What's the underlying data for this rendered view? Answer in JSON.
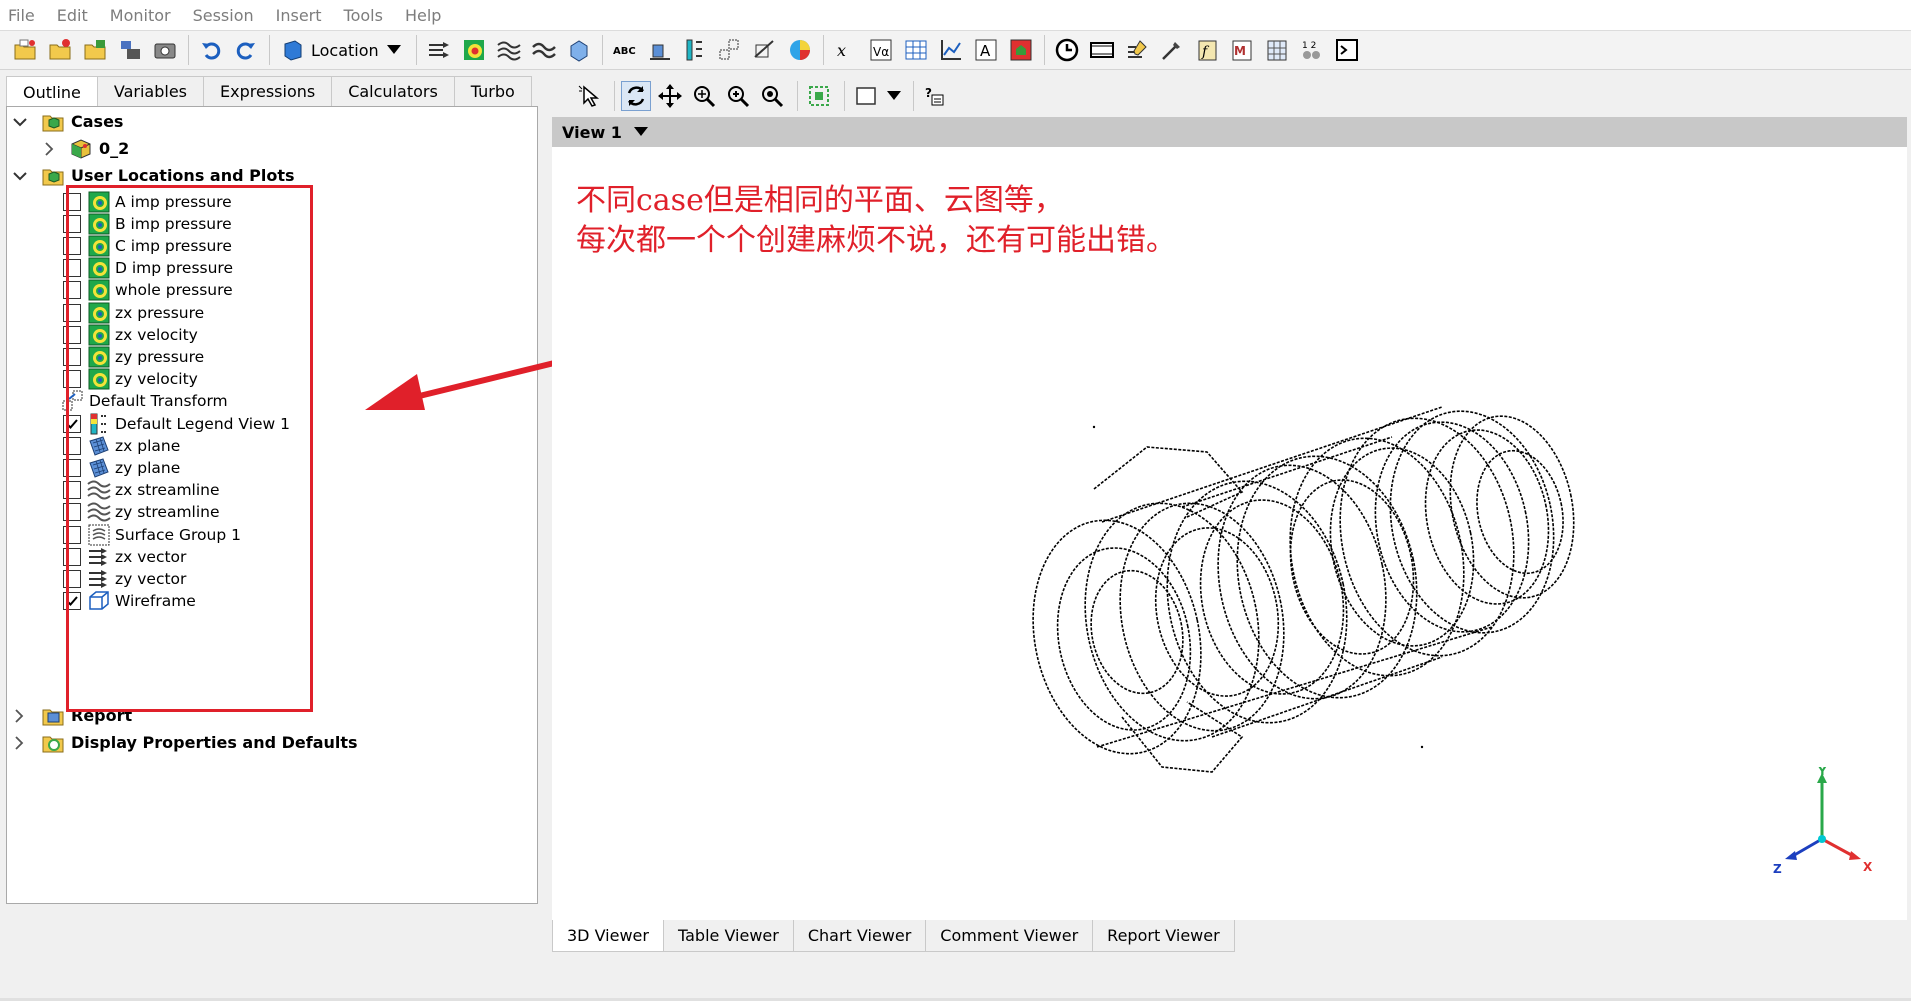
{
  "menu": [
    "File",
    "Edit",
    "Monitor",
    "Session",
    "Insert",
    "Tools",
    "Help"
  ],
  "toolbar": {
    "location_label": "Location"
  },
  "left_tabs": [
    {
      "label": "Outline",
      "active": true
    },
    {
      "label": "Variables",
      "active": false
    },
    {
      "label": "Expressions",
      "active": false
    },
    {
      "label": "Calculators",
      "active": false
    },
    {
      "label": "Turbo",
      "active": false
    }
  ],
  "tree": {
    "cases": {
      "label": "Cases",
      "children": [
        {
          "label": "0_2"
        }
      ]
    },
    "user_locations": {
      "label": "User Locations and Plots",
      "items": [
        {
          "label": "A imp pressure",
          "icon": "contour-icon",
          "checked": false
        },
        {
          "label": "B imp pressure",
          "icon": "contour-icon",
          "checked": false
        },
        {
          "label": "C imp pressure",
          "icon": "contour-icon",
          "checked": false
        },
        {
          "label": "D imp pressure",
          "icon": "contour-icon",
          "checked": false
        },
        {
          "label": "whole pressure",
          "icon": "contour-icon",
          "checked": false
        },
        {
          "label": "zx pressure",
          "icon": "contour-icon",
          "checked": false
        },
        {
          "label": "zx velocity",
          "icon": "contour-icon",
          "checked": false
        },
        {
          "label": "zy pressure",
          "icon": "contour-icon",
          "checked": false
        },
        {
          "label": "zy velocity",
          "icon": "contour-icon",
          "checked": false
        },
        {
          "label": "Default Transform",
          "icon": "transform-icon",
          "checked": null
        },
        {
          "label": "Default Legend View 1",
          "icon": "legend-icon",
          "checked": true
        },
        {
          "label": "zx plane",
          "icon": "plane-icon",
          "checked": false
        },
        {
          "label": "zy plane",
          "icon": "plane-icon",
          "checked": false
        },
        {
          "label": "zx streamline",
          "icon": "streamline-icon",
          "checked": false
        },
        {
          "label": "zy streamline",
          "icon": "streamline-icon",
          "checked": false
        },
        {
          "label": "Surface Group 1",
          "icon": "surface-group-icon",
          "checked": false
        },
        {
          "label": "zx vector",
          "icon": "vector-icon",
          "checked": false
        },
        {
          "label": "zy vector",
          "icon": "vector-icon",
          "checked": false
        },
        {
          "label": "Wireframe",
          "icon": "wireframe-icon",
          "checked": true
        }
      ]
    },
    "report": {
      "label": "Report"
    },
    "display": {
      "label": "Display Properties and Defaults"
    }
  },
  "view": {
    "title": "View 1",
    "annotation_line1": "不同case但是相同的平面、云图等，",
    "annotation_line2": "每次都一个个创建麻烦不说，还有可能出错。",
    "axes": {
      "x": "X",
      "y": "Y",
      "z": "Z"
    }
  },
  "bottom_tabs": [
    {
      "label": "3D Viewer",
      "active": true
    },
    {
      "label": "Table Viewer",
      "active": false
    },
    {
      "label": "Chart Viewer",
      "active": false
    },
    {
      "label": "Comment Viewer",
      "active": false
    },
    {
      "label": "Report Viewer",
      "active": false
    }
  ],
  "colors": {
    "annotation": "#e0202a",
    "accent_blue": "#1c5fbf",
    "cyan": "#00aeb8"
  }
}
